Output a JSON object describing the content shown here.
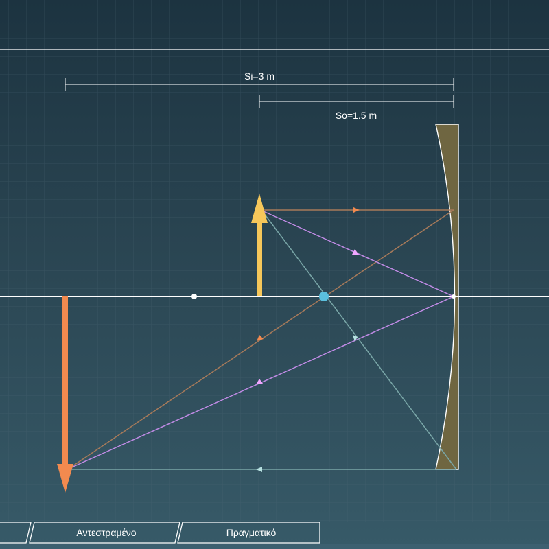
{
  "labels": {
    "image_distance": "Si=3 m",
    "object_distance": "So=1.5 m"
  },
  "tabs": [
    {
      "label": ""
    },
    {
      "label": "Αντεστραμένο"
    },
    {
      "label": "Πραγματικό"
    }
  ],
  "colors": {
    "optical_axis": "#ffffff",
    "object_arrow": "#f6c75a",
    "image_arrow": "#f28a4f",
    "ray_parallel": "#a77a5a",
    "ray_center": "#c18be6",
    "ray_focal": "#7aa7a8",
    "focal_point": "#5bc0de",
    "mirror_fill": "#6f6641",
    "grid": "#4f6b78"
  },
  "icons": {
    "ray_direction": "triangle-arrowhead"
  }
}
